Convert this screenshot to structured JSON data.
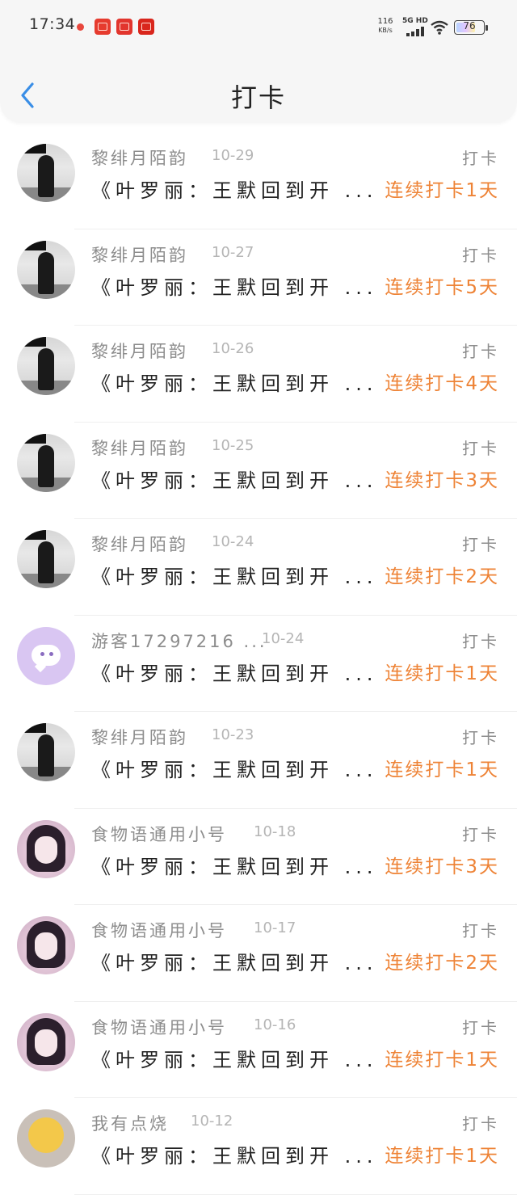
{
  "status_bar": {
    "time": "17:34",
    "net_speed_value": "116",
    "net_speed_unit": "KB/s",
    "signal_label": "5G HD",
    "battery_percent": "76",
    "battery_level": 0.76
  },
  "header": {
    "title": "打卡"
  },
  "list": [
    {
      "name": "黎绯月陌韵",
      "date": "10-29",
      "type": "打卡",
      "content": "《叶罗丽：王默回到开 ...",
      "streak": "连续打卡1天",
      "avatar": "dark"
    },
    {
      "name": "黎绯月陌韵",
      "date": "10-27",
      "type": "打卡",
      "content": "《叶罗丽：王默回到开 ...",
      "streak": "连续打卡5天",
      "avatar": "dark"
    },
    {
      "name": "黎绯月陌韵",
      "date": "10-26",
      "type": "打卡",
      "content": "《叶罗丽：王默回到开 ...",
      "streak": "连续打卡4天",
      "avatar": "dark"
    },
    {
      "name": "黎绯月陌韵",
      "date": "10-25",
      "type": "打卡",
      "content": "《叶罗丽：王默回到开 ...",
      "streak": "连续打卡3天",
      "avatar": "dark"
    },
    {
      "name": "黎绯月陌韵",
      "date": "10-24",
      "type": "打卡",
      "content": "《叶罗丽：王默回到开 ...",
      "streak": "连续打卡2天",
      "avatar": "dark"
    },
    {
      "name": "游客17297216 ...",
      "date": "10-24",
      "type": "打卡",
      "content": "《叶罗丽：王默回到开 ...",
      "streak": "连续打卡1天",
      "avatar": "purple"
    },
    {
      "name": "黎绯月陌韵",
      "date": "10-23",
      "type": "打卡",
      "content": "《叶罗丽：王默回到开 ...",
      "streak": "连续打卡1天",
      "avatar": "dark"
    },
    {
      "name": "食物语通用小号",
      "date": "10-18",
      "type": "打卡",
      "content": "《叶罗丽：王默回到开 ...",
      "streak": "连续打卡3天",
      "avatar": "doll"
    },
    {
      "name": "食物语通用小号",
      "date": "10-17",
      "type": "打卡",
      "content": "《叶罗丽：王默回到开 ...",
      "streak": "连续打卡2天",
      "avatar": "doll"
    },
    {
      "name": "食物语通用小号",
      "date": "10-16",
      "type": "打卡",
      "content": "《叶罗丽：王默回到开 ...",
      "streak": "连续打卡1天",
      "avatar": "doll"
    },
    {
      "name": "我有点烧",
      "date": "10-12",
      "type": "打卡",
      "content": "《叶罗丽：王默回到开 ...",
      "streak": "连续打卡1天",
      "avatar": "emoji"
    }
  ]
}
